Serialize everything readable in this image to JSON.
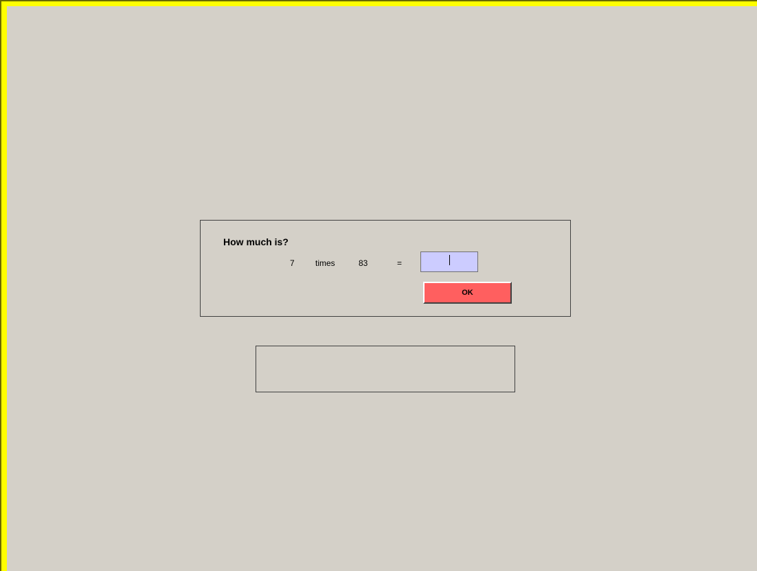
{
  "quiz": {
    "prompt": "How much is?",
    "operand_a": "7",
    "operator": "times",
    "operand_b": "83",
    "equals": "=",
    "answer_value": "",
    "ok_label": "OK"
  },
  "feedback": {
    "message": ""
  },
  "colors": {
    "frame_border": "#ffff00",
    "background": "#d4d0c8",
    "input_background": "#ccccff",
    "ok_button": "#ff5f5f"
  }
}
